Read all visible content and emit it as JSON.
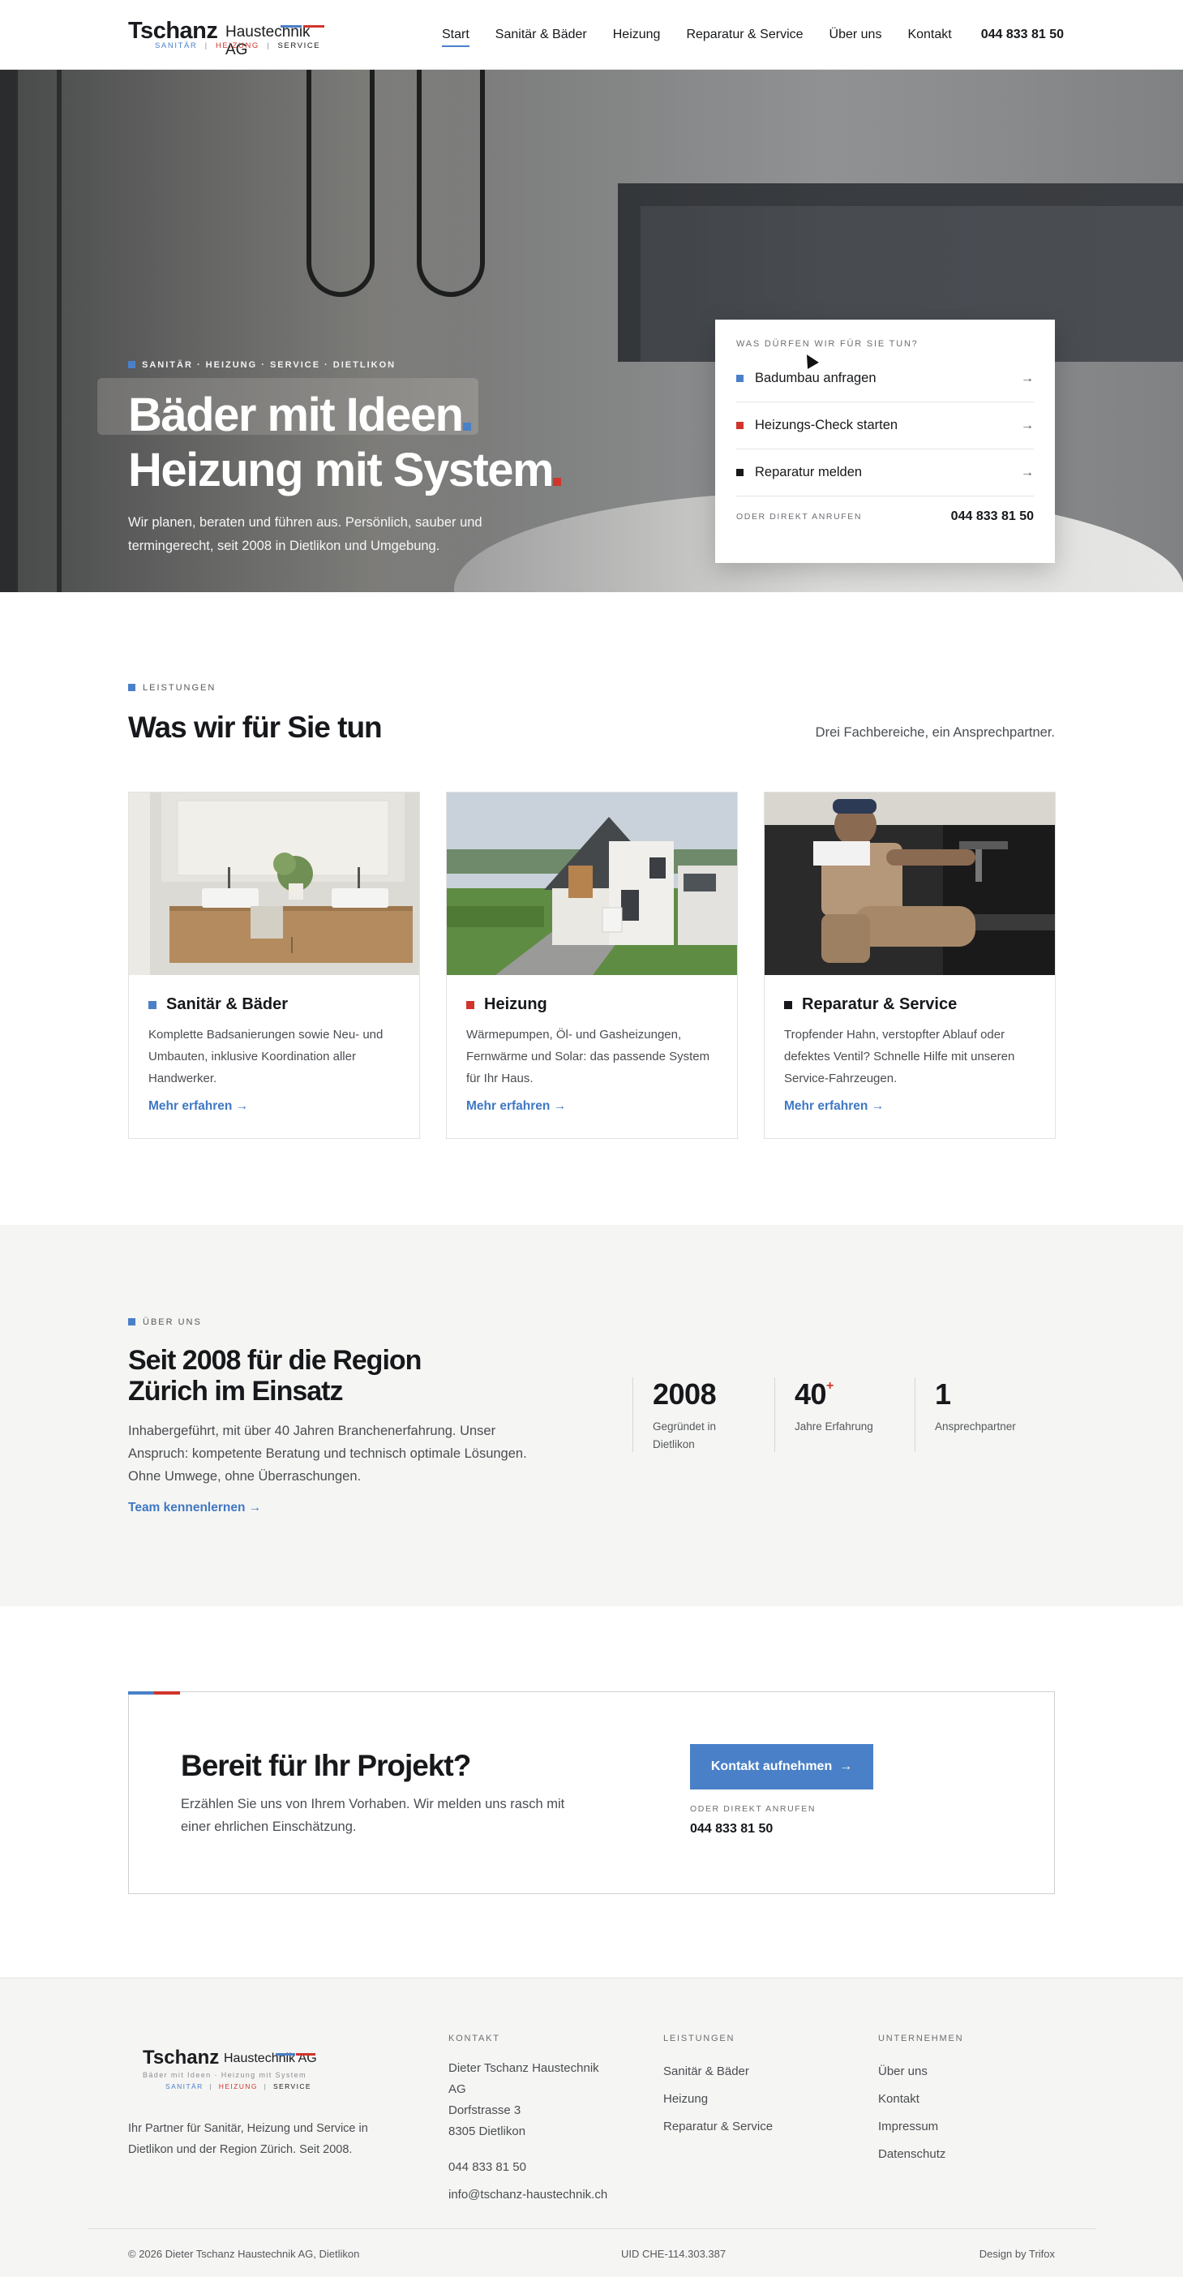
{
  "brand": {
    "name": "Tschanz",
    "suffix": "Haustechnik AG",
    "tags": [
      "SANITÄR",
      "|",
      "HEIZUNG",
      "|",
      "SERVICE"
    ],
    "colors": {
      "blue": "#4a80c8",
      "red": "#d0352c",
      "dark": "#16181b"
    }
  },
  "nav": {
    "items": [
      "Start",
      "Sanitär & Bäder",
      "Heizung",
      "Reparatur & Service",
      "Über uns",
      "Kontakt"
    ],
    "active": "Start",
    "phone": "044 833 81 50"
  },
  "hero": {
    "kicker": "SANITÄR · HEIZUNG · SERVICE · DIETLIKON",
    "title_line1": "Bäder mit Ideen",
    "title_line2": "Heizung mit System",
    "lead": "Wir planen, beraten und führen aus. Persönlich, sauber und termingerecht, seit 2008 in Dietlikon und Umgebung.",
    "quick": {
      "heading": "WAS DÜRFEN WIR FÜR SIE TUN?",
      "items": [
        {
          "label": "Badumbau anfragen",
          "color": "#4a80c8",
          "icon": "arrow-right-icon"
        },
        {
          "label": "Heizungs-Check starten",
          "color": "#d0352c",
          "icon": "arrow-right-icon"
        },
        {
          "label": "Reparatur melden",
          "color": "#16181b",
          "icon": "arrow-right-icon"
        }
      ],
      "footer_label": "ODER DIREKT ANRUFEN",
      "footer_phone": "044 833 81 50"
    }
  },
  "services": {
    "kicker": "LEISTUNGEN",
    "title": "Was wir für Sie tun",
    "aside": "Drei Fachbereiche, ein Ansprechpartner.",
    "cards": [
      {
        "title": "Sanitär & Bäder",
        "color": "#4a80c8",
        "text": "Komplette Badsanierungen sowie Neu- und Umbauten, inklusive Koordination aller Handwerker.",
        "link": "Mehr erfahren"
      },
      {
        "title": "Heizung",
        "color": "#d0352c",
        "text": "Wärmepumpen, Öl- und Gasheizungen, Fernwärme und Solar: das passende System für Ihr Haus.",
        "link": "Mehr erfahren"
      },
      {
        "title": "Reparatur & Service",
        "color": "#16181b",
        "text": "Tropfender Hahn, verstopfter Ablauf oder defektes Ventil? Schnelle Hilfe mit unseren Service-Fahrzeugen.",
        "link": "Mehr erfahren"
      }
    ]
  },
  "about": {
    "kicker": "ÜBER UNS",
    "title_line1": "Seit 2008 für die Region",
    "title_line2": "Zürich im Einsatz",
    "text": "Inhabergeführt, mit über 40 Jahren Branchenerfahrung. Unser Anspruch: kompetente Beratung und technisch optimale Lösungen. Ohne Umwege, ohne Überraschungen.",
    "link": "Team kennenlernen",
    "stats": [
      {
        "value": "2008",
        "suffix": "",
        "label": "Gegründet in Dietlikon"
      },
      {
        "value": "40",
        "suffix": "+",
        "label": "Jahre Erfahrung"
      },
      {
        "value": "1",
        "suffix": "",
        "label": "Ansprechpartner"
      }
    ]
  },
  "cta": {
    "title": "Bereit für Ihr Projekt?",
    "text": "Erzählen Sie uns von Ihrem Vorhaben. Wir melden uns rasch mit einer ehrlichen Einschätzung.",
    "button": "Kontakt aufnehmen",
    "label": "ODER DIREKT ANRUFEN",
    "phone": "044 833 81 50"
  },
  "footer": {
    "logo_sub": "Bäder mit Ideen · Heizung mit System",
    "about": "Ihr Partner für Sanitär, Heizung und Service in Dietlikon und der Region Zürich. Seit 2008.",
    "contact": {
      "heading": "KONTAKT",
      "company": "Dieter Tschanz Haustechnik AG",
      "street": "Dorfstrasse 3",
      "city": "8305 Dietlikon",
      "phone": "044 833 81 50",
      "email": "info@tschanz-haustechnik.ch"
    },
    "services": {
      "heading": "LEISTUNGEN",
      "items": [
        "Sanitär & Bäder",
        "Heizung",
        "Reparatur & Service"
      ]
    },
    "company": {
      "heading": "UNTERNEHMEN",
      "items": [
        "Über uns",
        "Kontakt",
        "Impressum",
        "Datenschutz"
      ]
    },
    "copyright": "© 2026 Dieter Tschanz Haustechnik AG, Dietlikon",
    "uid": "UID CHE-114.303.387",
    "credit": "Design by Trifox"
  }
}
